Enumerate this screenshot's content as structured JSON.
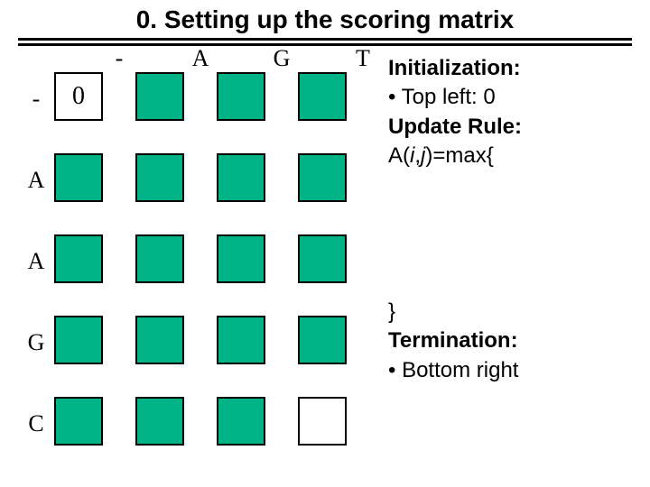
{
  "title": "0. Setting up the scoring matrix",
  "col_headers": [
    "-",
    "A",
    "G",
    "T"
  ],
  "row_headers": [
    "-",
    "A",
    "A",
    "G",
    "C"
  ],
  "cells": {
    "r0c0": "0"
  },
  "notes_top": {
    "init_hdr": "Initialization:",
    "init_b1": "Top left: 0",
    "upd_hdr": "Update Rule:",
    "upd_line_prefix": "A(",
    "upd_line_i": "i",
    "upd_line_sep": ",",
    "upd_line_j": "j",
    "upd_line_suffix": ")=max{"
  },
  "notes_bottom": {
    "closebrace": "}",
    "term_hdr": "Termination:",
    "term_b1": "Bottom right"
  },
  "chart_data": {
    "type": "table",
    "title": "Scoring matrix initialization",
    "columns": [
      "-",
      "A",
      "G",
      "T"
    ],
    "rows": [
      "-",
      "A",
      "A",
      "G",
      "C"
    ],
    "filled_cells": [
      {
        "row": 0,
        "col": 0,
        "value": 0
      }
    ],
    "note": "All other cells shown empty (green). Bottom-right cell drawn white/empty."
  }
}
